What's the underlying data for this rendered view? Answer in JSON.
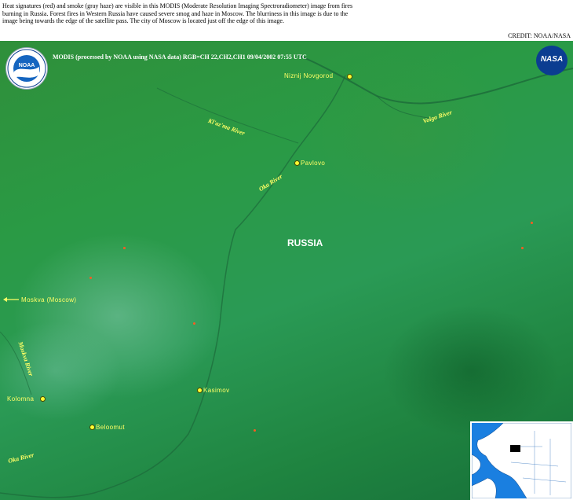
{
  "caption": "Heat signatures (red) and smoke (gray haze) are visible in this MODIS (Moderate Resolution Imaging Spectroradiometer) image from fires burning in Russia.  Forest fires in Western Russia have caused severe smog and haze in Moscow.  The blurriness in this image is due to the image being towards the edge of the satellite pass.  The city of Moscow is located just off the edge of this image.",
  "credit": "CREDIT: NOAA/NASA",
  "header_line": "MODIS  (processed by NOAA using NASA data)  RGB=CH 22,CH2,CH1  09/04/2002  07:55 UTC",
  "logos": {
    "noaa_text": "NOAA",
    "nasa_text": "NASA"
  },
  "country": "RUSSIA",
  "cities": [
    {
      "name": "Niznij Novgorod"
    },
    {
      "name": "Pavlovo"
    },
    {
      "name": "Moskva (Moscow)"
    },
    {
      "name": "Kasimov"
    },
    {
      "name": "Kolomna"
    },
    {
      "name": "Beloomut"
    }
  ],
  "rivers": [
    {
      "name": "Kl'az'ma River"
    },
    {
      "name": "Volga River"
    },
    {
      "name": "Oka River"
    },
    {
      "name": "Moskva River"
    },
    {
      "name": "Oka River"
    }
  ],
  "colors": {
    "vegetation": "#2a9a45",
    "labels": "#ffff66",
    "fires": "#ff5a20",
    "water_inset": "#1a7fe0"
  }
}
